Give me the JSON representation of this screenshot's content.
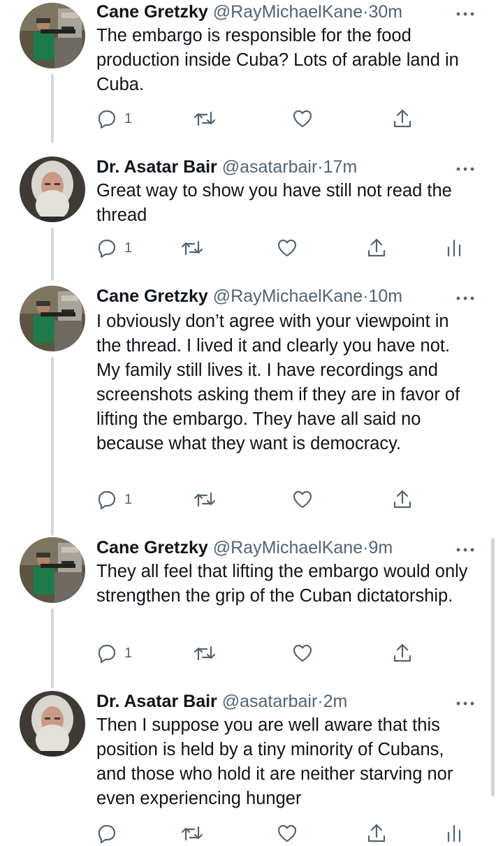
{
  "tweets": [
    {
      "author": "Cane Gretzky",
      "handle": "@RayMichaelKane",
      "separator": "·",
      "time": "30m",
      "text": "The embargo is responsible for the food production inside Cuba? Lots of arable land in Cuba.",
      "reply_count": "1",
      "avatar": "man-with-rifle-photo"
    },
    {
      "author": "Dr. Asatar Bair",
      "handle": "@asatarbair",
      "separator": "·",
      "time": "17m",
      "text": "Great way to show you have still not read the thread",
      "reply_count": "1",
      "avatar": "white-bearded-man-photo"
    },
    {
      "author": "Cane Gretzky",
      "handle": "@RayMichaelKane",
      "separator": "·",
      "time": "10m",
      "text": "I obviously don’t agree with your viewpoint in the thread. I lived it and clearly you have not. My family still lives it. I have recordings and screenshots asking them if they are in favor of lifting the embargo. They have all said no because what they want is democracy.",
      "reply_count": "1",
      "avatar": "man-with-rifle-photo"
    },
    {
      "author": "Cane Gretzky",
      "handle": "@RayMichaelKane",
      "separator": "·",
      "time": "9m",
      "text": "They all feel that lifting the embargo would only strengthen the grip of the Cuban dictatorship.",
      "reply_count": "1",
      "avatar": "man-with-rifle-photo"
    },
    {
      "author": "Dr. Asatar Bair",
      "handle": "@asatarbair",
      "separator": "·",
      "time": "2m",
      "text": "Then I suppose you are well aware that this position is held by a tiny minority of Cubans, and those who hold it are neither starving nor even experiencing hunger",
      "reply_count": "",
      "avatar": "white-bearded-man-photo"
    }
  ],
  "icons": {
    "reply": "reply-icon",
    "retweet": "retweet-icon",
    "like": "heart-icon",
    "share": "share-icon",
    "analytics": "analytics-icon",
    "more": "more-options-icon"
  },
  "colors": {
    "text": "#0f1419",
    "muted": "#536471",
    "thread_line": "#cfd9de",
    "icon": "#536471"
  }
}
